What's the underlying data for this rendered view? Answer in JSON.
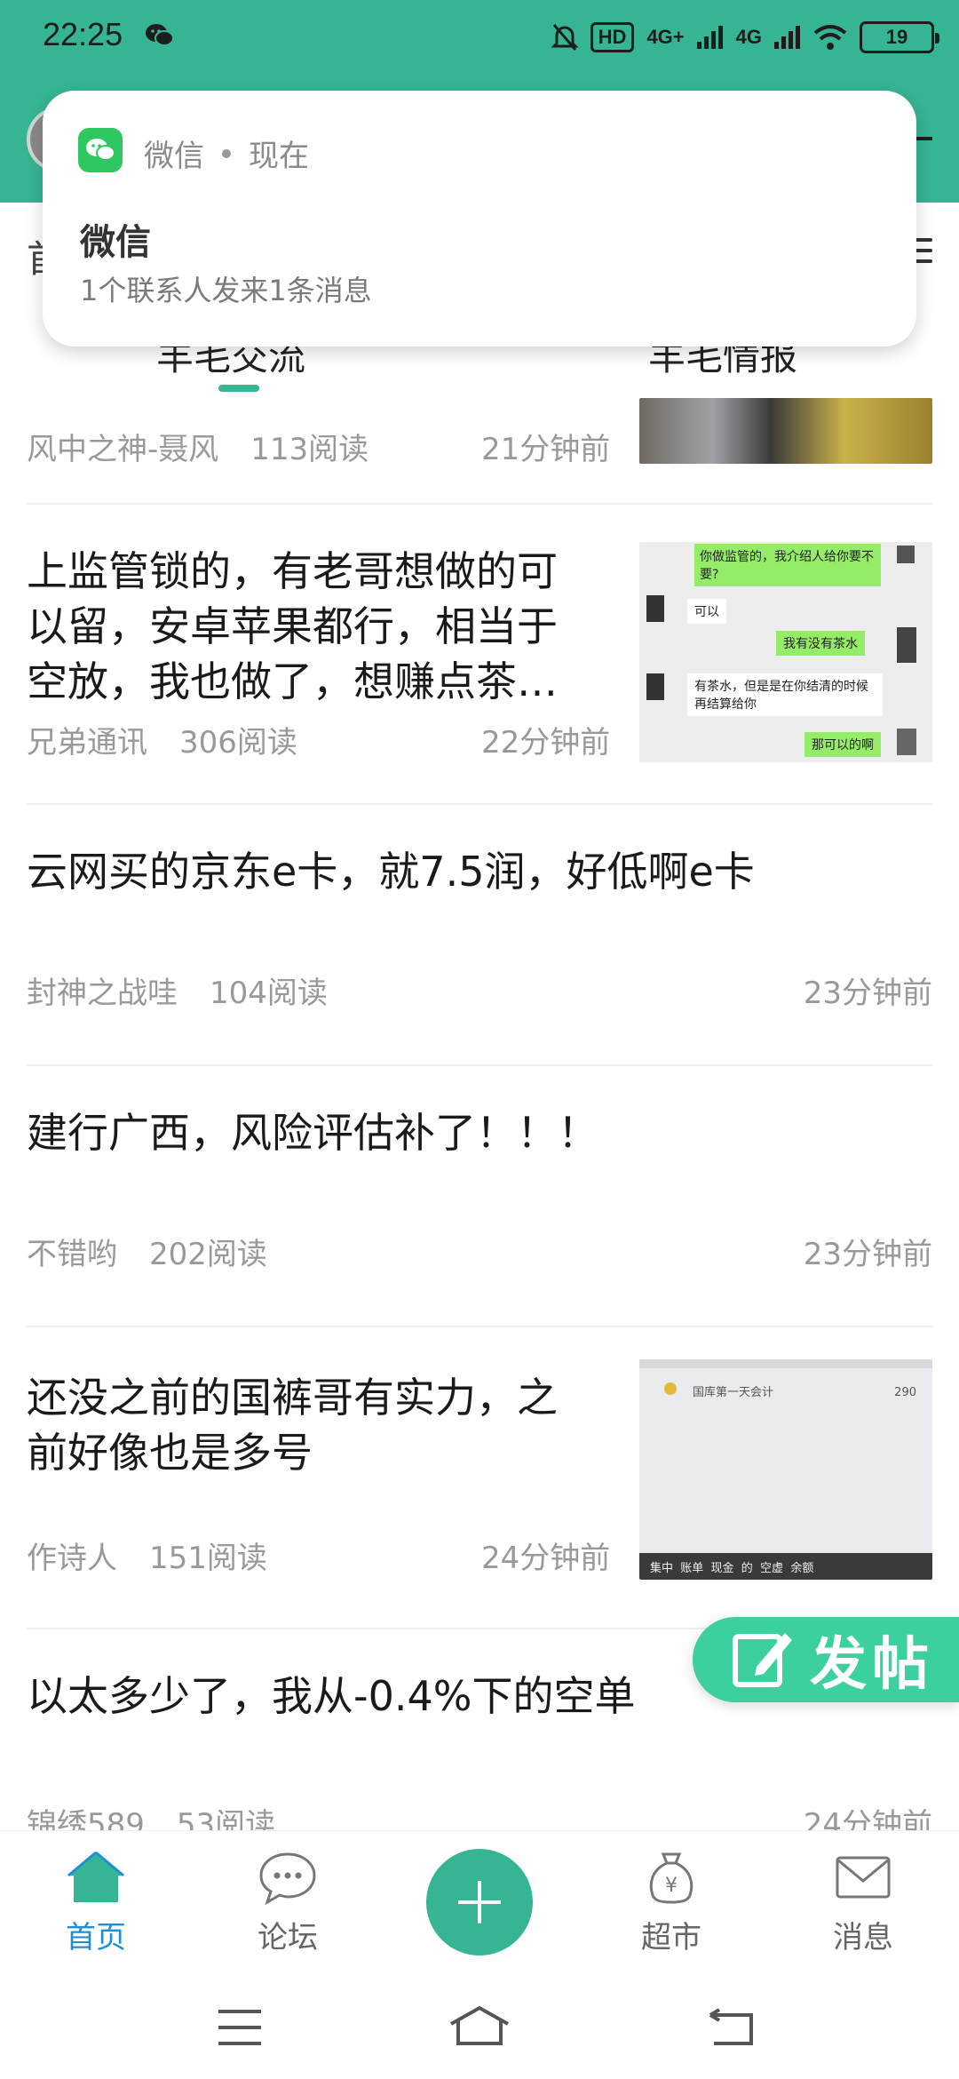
{
  "status_bar": {
    "time": "22:25",
    "network_badge": "HD",
    "signal1": "4G+",
    "signal2": "4G",
    "battery": "19"
  },
  "notification": {
    "app_name": "微信",
    "when": "现在",
    "title": "微信",
    "body": "1个联系人发来1条消息"
  },
  "subnav": {
    "first_char": "首",
    "tabs": [
      "羊毛交流",
      "羊毛情报"
    ]
  },
  "posts": [
    {
      "title": "",
      "author": "风中之神-聂风",
      "reads": "113阅读",
      "time": "21分钟前",
      "has_thumb": true
    },
    {
      "title": "上监管锁的，有老哥想做的可以留，安卓苹果都行，相当于空放，我也做了，想赚点茶…",
      "author": "兄弟通讯",
      "reads": "306阅读",
      "time": "22分钟前",
      "has_thumb": true
    },
    {
      "title": "云网买的京东e卡，就7.5润，好低啊e卡",
      "author": "封神之战哇",
      "reads": "104阅读",
      "time": "23分钟前",
      "has_thumb": false
    },
    {
      "title": "建行广西，风险评估补了！！！",
      "author": "不错哟",
      "reads": "202阅读",
      "time": "23分钟前",
      "has_thumb": false
    },
    {
      "title": "还没之前的国裤哥有实力，之前好像也是多号",
      "author": "作诗人",
      "reads": "151阅读",
      "time": "24分钟前",
      "has_thumb": true
    },
    {
      "title": "以太多少了，我从-0.4%下的空单",
      "author": "锦绣589",
      "reads": "53阅读",
      "time": "24分钟前",
      "has_thumb": false
    }
  ],
  "chat_thumb": {
    "line1": "你做监管的，我介绍人给你要不要?",
    "line2": "可以",
    "line3": "我有没有茶水",
    "line4": "有茶水，但是是在你结清的时候再结算给你",
    "line5": "那可以的啊"
  },
  "account_thumb": {
    "header": "国库第一天会计",
    "amount": "290",
    "tabs": "集中  账单  现金  的  空虚  余额"
  },
  "fab": {
    "label": "发帖"
  },
  "bottom_nav": [
    {
      "label": "首页",
      "active": true
    },
    {
      "label": "论坛",
      "active": false
    },
    {
      "label": "超市",
      "active": false
    },
    {
      "label": "消息",
      "active": false
    }
  ],
  "colors": {
    "brand_green": "#36b594",
    "active_blue": "#1e8fd6",
    "fab_green": "#3bd09c"
  }
}
